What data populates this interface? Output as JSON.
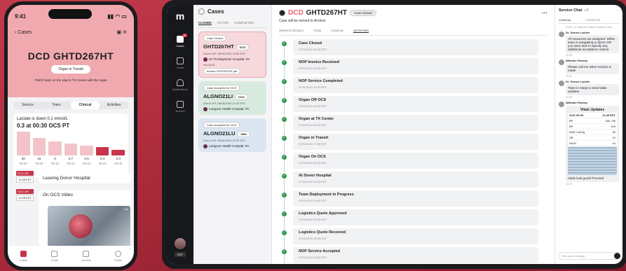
{
  "phone": {
    "time": "9:41",
    "back_label": "Cases",
    "title": "DCD GHTD267HT",
    "status": "Organ in Transit",
    "subtitle": "TMOX team on the way to TX Center with the organ",
    "tabs": [
      "Service",
      "Team",
      "Clinical",
      "Activities"
    ],
    "active_tab": "Clinical",
    "lactate": {
      "text": "Lactate is down 0.1 mmol/L",
      "value": "0.3 at 00:30 OCS PT",
      "bars": [
        {
          "v": "20",
          "t": "00:00",
          "level": 20
        },
        {
          "v": "15",
          "t": "00:05",
          "level": 15
        },
        {
          "v": "0",
          "t": "00:10",
          "level": 12
        },
        {
          "v": "0.7",
          "t": "00:15",
          "level": 10
        },
        {
          "v": "0.5",
          "t": "00:20",
          "level": 8
        },
        {
          "v": "0.4",
          "t": "00:25",
          "level": 7
        },
        {
          "v": "0.3",
          "t": "00:30",
          "level": 5
        }
      ]
    },
    "events": [
      {
        "tag": "OCS OR",
        "time": "12:45 EST",
        "label": "Leaving Donor Hospital"
      },
      {
        "tag": "OCS OR",
        "time": "12:45 EST",
        "label": "On OCS Video"
      }
    ],
    "video_count": "12s",
    "bottom_nav": [
      "Cases",
      "Chats",
      "Archive",
      "Profile"
    ]
  },
  "sidebar": {
    "logo": "m",
    "items": [
      "Cases",
      "Chats",
      "Notifications",
      "Archive"
    ],
    "badge": "8",
    "tz": "EST"
  },
  "cases": {
    "title": "Cases",
    "tabs": [
      "CLOSED",
      "ACTIVE",
      "COMPLETED"
    ],
    "cards": [
      {
        "tag": "Case Closed",
        "name": "GHTD267HT",
        "chip": "DCD",
        "donor": "Donor OR: 08/16/2024 18:30 EST",
        "hospital": "NY Presbyterian Hospital, PA",
        "invoice_label": "INVOICE",
        "invoice_file": "Invoice GHTD267HT.pdf",
        "color": "#f7d8dc",
        "border": "#e9a5ae"
      },
      {
        "tag": "Case Accepted for OCS",
        "name": "ALGNO21LI",
        "chip": "DCD",
        "donor": "Donor OR: 08/16/2024 21:30 EST",
        "hospital": "Langone Health Hospital, PA",
        "color": "#d9ebe0",
        "border": "#d9ebe0"
      },
      {
        "tag": "Case Accepted for OCS",
        "name": "ALGNO21LU",
        "chip": "DBD",
        "donor": "Donor OR: 08/16/2024 22:30 EST",
        "hospital": "Langone Health Hospital, PA",
        "color": "#dbe6f2",
        "border": "#dbe6f2"
      }
    ]
  },
  "main": {
    "prefix": "DCD",
    "title": "GHTD267HT",
    "status": "Case Closed",
    "subtitle": "Case will be moved to Archive",
    "tabs": [
      "SERVICE DETAILS",
      "TEAM",
      "CLINICAL",
      "ACTIVITIES"
    ],
    "activities": [
      {
        "name": "Case Closed",
        "ts": "07/31/2024 18:23 EST"
      },
      {
        "name": "NOP Invoice Received",
        "ts": "07/31/2024 18:23 EST"
      },
      {
        "name": "NOP Service Completed",
        "ts": "07/31/2024 18:23 EST"
      },
      {
        "name": "Organ Off OCS",
        "ts": "07/31/2024 20:29 EST"
      },
      {
        "name": "Organ at TX Center",
        "ts": "07/31/2024 18:23 EST"
      },
      {
        "name": "Organ in Transit",
        "ts": "07/31/2024 17:09 EST"
      },
      {
        "name": "Organ On OCS",
        "ts": "07/31/2024 16:23 EST"
      },
      {
        "name": "At Donor Hospital",
        "ts": "07/31/2024 18:23 EST"
      },
      {
        "name": "Team Deployment in Progress",
        "ts": "07/31/2024 18:09 EST"
      },
      {
        "name": "Logistics Quote Approved",
        "ts": "07/31/2024 18:23 EST"
      },
      {
        "name": "Logistics Quote Received",
        "ts": "07/31/2024 18:23 EST"
      },
      {
        "name": "NOP Service Accepted",
        "ts": "07/31/2024 18:23 EST"
      }
    ]
  },
  "chat": {
    "title": "Service Chat",
    "count": "+2",
    "tabs": [
      "CLINICAL",
      "LOGISTICS"
    ],
    "notice": "TODO: Cr. Malcolm Hinkson added to chat",
    "messages": [
      {
        "who": "Dr. Gonzo Lucider",
        "text": "All resources are assigned. White team is navigating to donor OR you have time to specify any additional acceptance criteria",
        "time": "10:25"
      },
      {
        "who": "Winston Parsley",
        "text": "Please call me when incision is made",
        "time": "10:30"
      },
      {
        "who": "Dr. Gonzo Lucider",
        "text": "Team is ready to send vitals updates",
        "time": "10:45"
      }
    ],
    "vitals": {
      "author": "Winston Parsley",
      "title": "Vitals Updates",
      "header": [
        "OCS 00:05",
        "11:45 EST"
      ],
      "rows": [
        [
          "BP",
          "180 / 85"
        ],
        [
          "BP",
          "100"
        ],
        [
          "MAP, mmHg",
          "96"
        ],
        [
          "SB",
          "22"
        ],
        [
          "SaO2",
          "44"
        ]
      ]
    },
    "last": "Vitals look good! Proceed",
    "last_time": "10:00",
    "placeholder": "Text your message"
  }
}
